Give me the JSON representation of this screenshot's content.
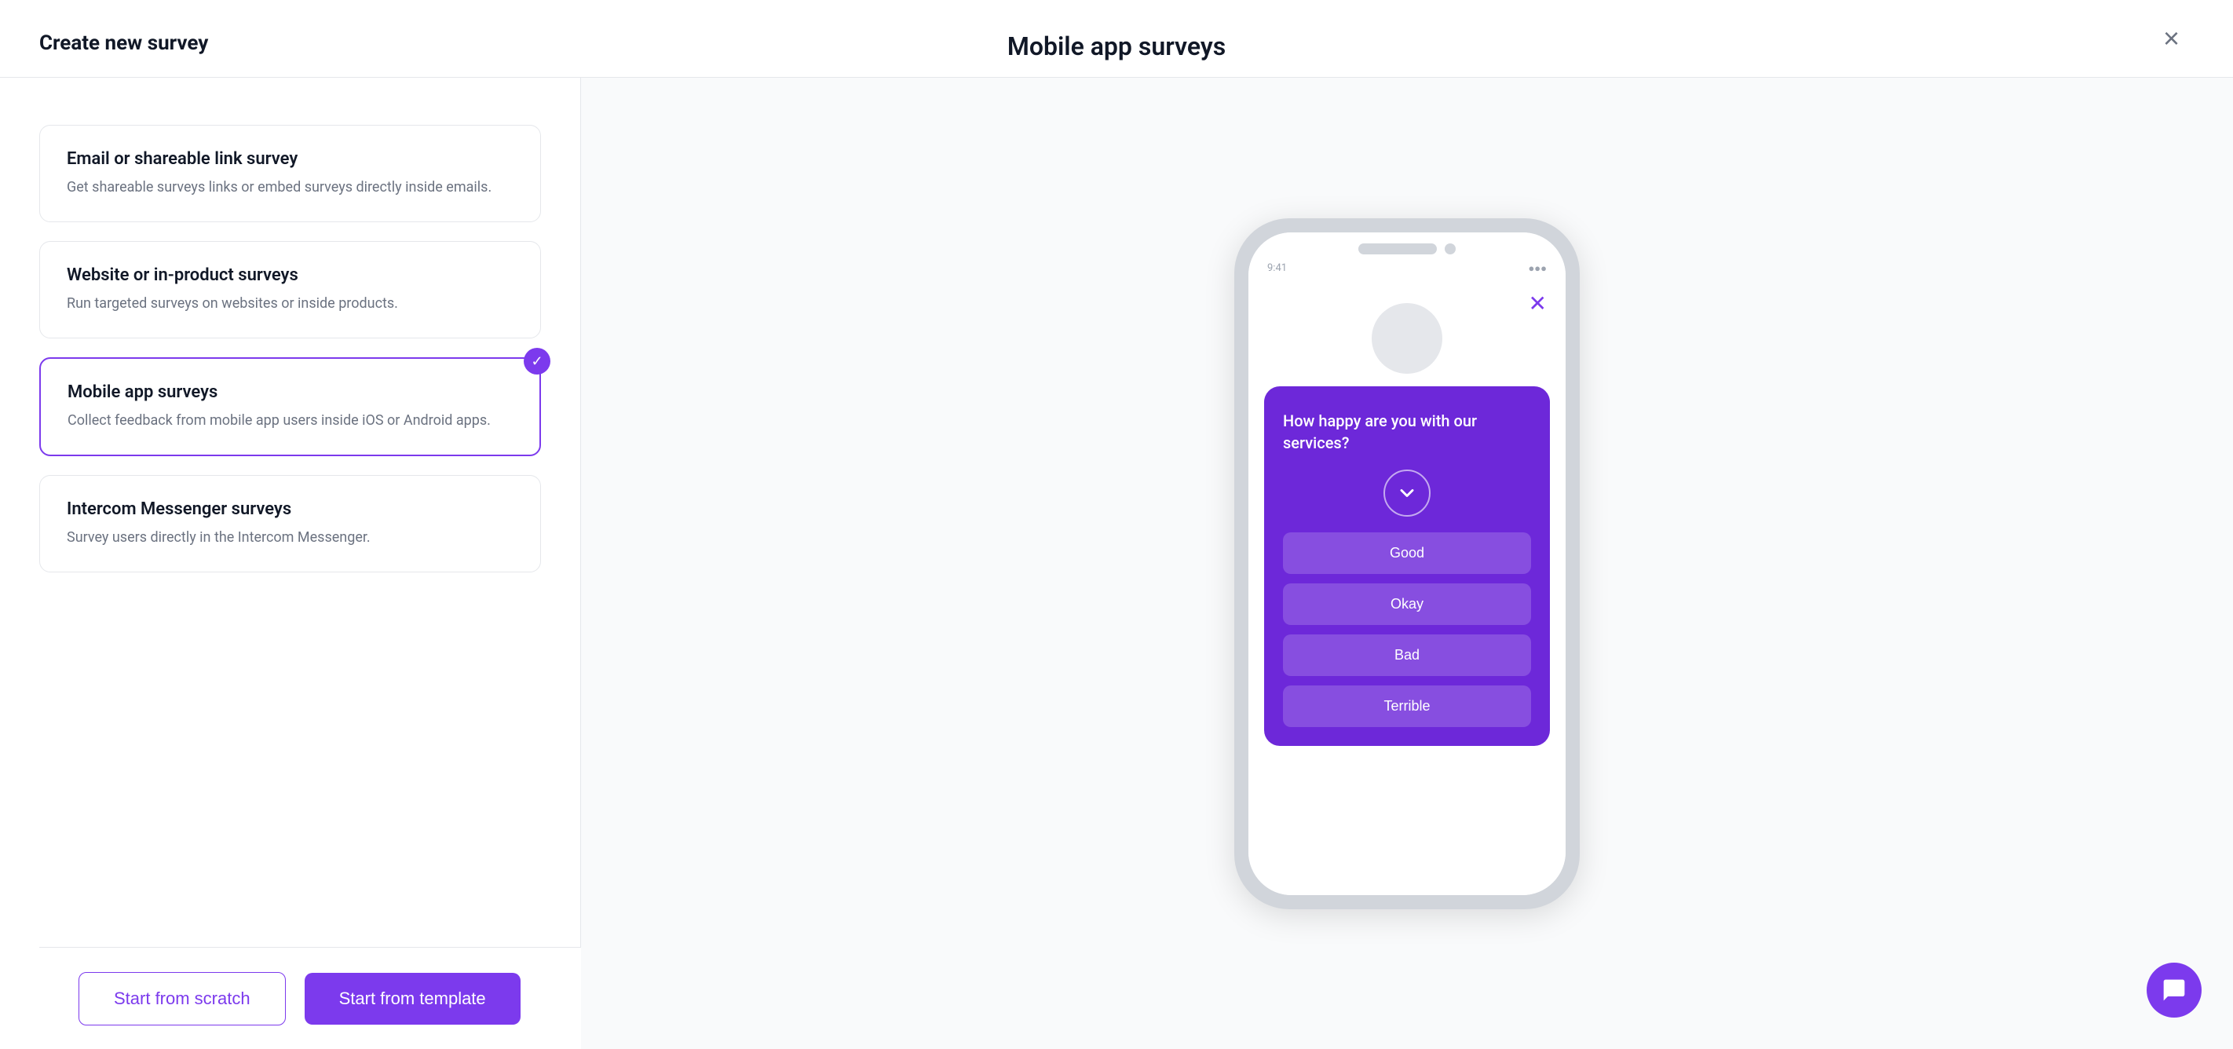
{
  "modal": {
    "title": "Mobile app surveys",
    "close_label": "×"
  },
  "left_panel": {
    "title": "Create new survey",
    "options": [
      {
        "id": "email",
        "title": "Email or shareable link survey",
        "description": "Get shareable surveys links or embed surveys directly inside emails.",
        "selected": false
      },
      {
        "id": "website",
        "title": "Website or in-product surveys",
        "description": "Run targeted surveys on websites or inside products.",
        "selected": false
      },
      {
        "id": "mobile",
        "title": "Mobile app surveys",
        "description": "Collect feedback from mobile app users inside iOS or Android apps.",
        "selected": true
      },
      {
        "id": "intercom",
        "title": "Intercom Messenger surveys",
        "description": "Survey users directly in the Intercom Messenger.",
        "selected": false
      }
    ]
  },
  "footer": {
    "scratch_label": "Start from scratch",
    "template_label": "Start from template"
  },
  "phone": {
    "status_left": "9:41",
    "status_right": "●●●",
    "survey": {
      "question": "How happy are you with our services?",
      "answers": [
        "Good",
        "Okay",
        "Bad",
        "Terrible"
      ]
    }
  },
  "chat_bubble": {
    "icon": "💬"
  }
}
